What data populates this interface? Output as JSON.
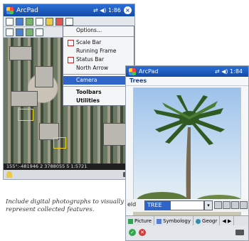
{
  "device1": {
    "app_title": "ArcPad",
    "status": "⇄ ◀) 1:86",
    "ok_label": "×",
    "menu": {
      "options": "Options...",
      "scale_bar": "Scale Bar",
      "running_frame": "Running Frame",
      "status_bar": "Status Bar",
      "north_arrow": "North Arrow",
      "camera": "Camera",
      "toolbars": "Toolbars",
      "utilities": "Utilities"
    },
    "statusbar_text": "155°:-481946 2 3788055 5 1:5721"
  },
  "device2": {
    "app_title": "ArcPad",
    "status": "⇄ ◀) 1:84",
    "form_title": "Trees",
    "field_label": "eld",
    "field_value": "TREE",
    "tabs": [
      "Picture",
      "Symbology",
      "Geogr"
    ],
    "nav_arrows": "◀ ▶"
  },
  "caption": "Include digital photographs to visually represent collected features.",
  "colors": {
    "titlebar": "#1b55b5",
    "menu_highlight": "#2f65c8"
  }
}
